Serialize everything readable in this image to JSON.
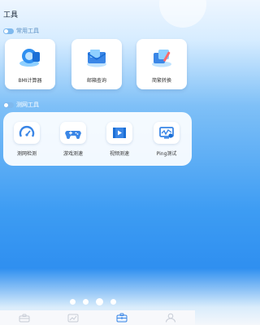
{
  "header": {
    "title": "工具"
  },
  "sections": {
    "common": {
      "label": "常用工具"
    },
    "network": {
      "label": "测网工具"
    }
  },
  "common_tools": [
    {
      "label": "BMI计算器",
      "icon": "bmi-calculator-icon"
    },
    {
      "label": "邮箱查询",
      "icon": "mailbox-query-icon"
    },
    {
      "label": "简繁转换",
      "icon": "text-convert-icon"
    }
  ],
  "network_tools": [
    {
      "label": "测网检测",
      "icon": "speedometer-icon"
    },
    {
      "label": "游戏测速",
      "icon": "gamepad-icon"
    },
    {
      "label": "视频测速",
      "icon": "video-icon"
    },
    {
      "label": "Ping测试",
      "icon": "ping-icon"
    }
  ],
  "pager": {
    "total": 4,
    "active_index": 2
  },
  "tabbar": [
    {
      "icon": "toolbox-icon"
    },
    {
      "icon": "chart-icon"
    },
    {
      "icon": "briefcase-icon",
      "active": true
    },
    {
      "icon": "profile-icon"
    }
  ],
  "colors": {
    "accent": "#2f8ff0",
    "icon_blue": "#3a86e6"
  }
}
